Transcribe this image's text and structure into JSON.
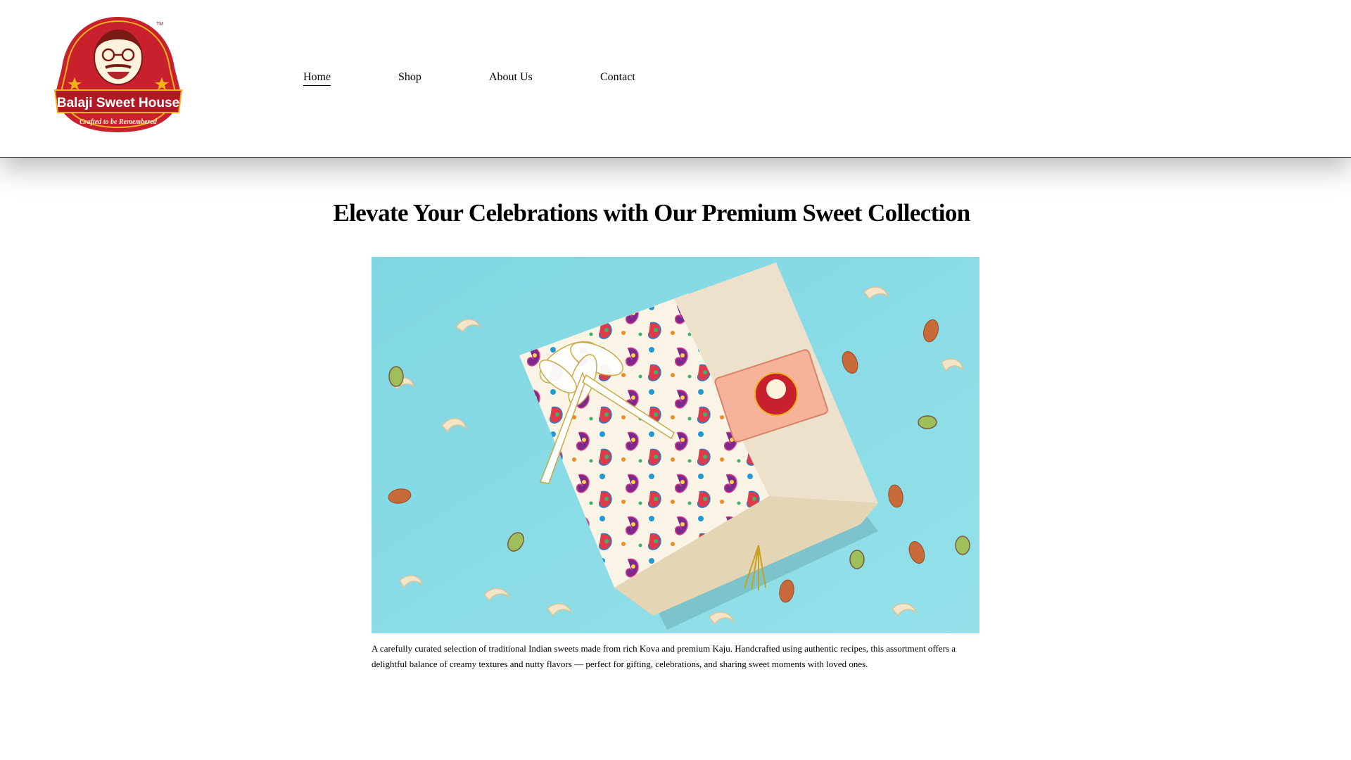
{
  "brand": {
    "name": "Balaji Sweet House",
    "tagline": "Crafted to be Remembered",
    "trademark": "TM",
    "colors": {
      "primary_red": "#c8202c",
      "gold": "#f2b21b",
      "cream": "#fdf3dc"
    }
  },
  "nav": {
    "items": [
      {
        "label": "Home",
        "active": true
      },
      {
        "label": "Shop",
        "active": false
      },
      {
        "label": "About Us",
        "active": false
      },
      {
        "label": "Contact",
        "active": false
      }
    ]
  },
  "main": {
    "title": "Elevate Your Celebrations with Our Premium Sweet Collection",
    "description": "A carefully curated selection of traditional Indian sweets made from rich Kova and premium Kaju. Handcrafted using authentic recipes, this assortment offers a delightful balance of creamy textures and nutty flavors — perfect for gifting, celebrations, and sharing sweet moments with loved ones.",
    "image": {
      "background_color": "#8fdde6",
      "label_text": "Balaji Sweet House",
      "label_tagline": "Crafted to be Remembered"
    }
  }
}
